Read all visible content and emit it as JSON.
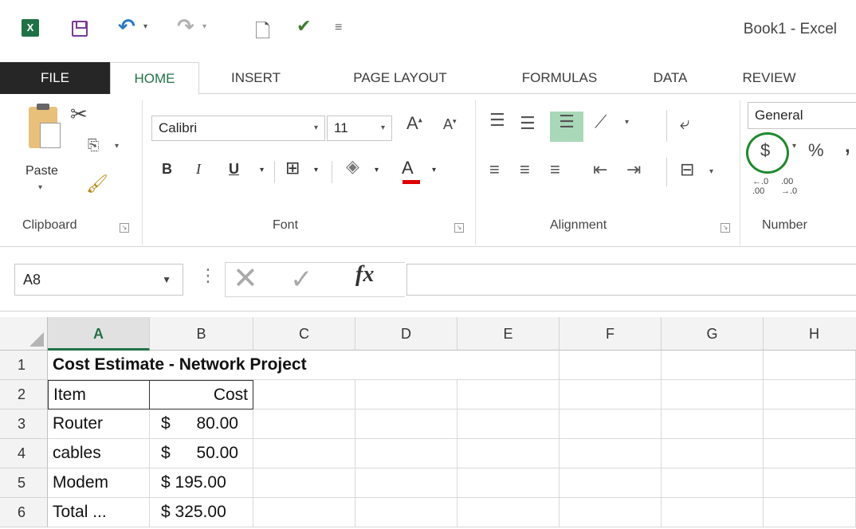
{
  "window": {
    "title": "Book1 - Excel"
  },
  "quick_access": {
    "logo_text": "X",
    "icons": [
      "excel-logo-icon",
      "save-icon",
      "undo-icon",
      "redo-icon",
      "print-preview-icon",
      "spelling-icon",
      "customize-qat-icon"
    ]
  },
  "tabs": {
    "file": "FILE",
    "home": "HOME",
    "insert": "INSERT",
    "page_layout": "PAGE LAYOUT",
    "formulas": "FORMULAS",
    "data": "DATA",
    "review": "REVIEW"
  },
  "ribbon": {
    "clipboard": {
      "paste_label": "Paste",
      "group_label": "Clipboard"
    },
    "font": {
      "font_name": "Calibri",
      "font_size": "11",
      "group_label": "Font",
      "bold": "B",
      "italic": "I",
      "underline": "U",
      "font_color": "#e00000"
    },
    "alignment": {
      "group_label": "Alignment"
    },
    "number": {
      "format": "General",
      "currency_symbol": "$",
      "percent_symbol": "%",
      "comma_symbol": ",",
      "increase_decimal": "←.0\n.00",
      "decrease_decimal": ".00\n→.0",
      "group_label": "Number",
      "highlight_color": "#1e8a2e"
    }
  },
  "formula_bar": {
    "name_box": "A8",
    "fx_label": "fx",
    "formula": ""
  },
  "grid": {
    "columns": [
      "A",
      "B",
      "C",
      "D",
      "E",
      "F",
      "G",
      "H"
    ],
    "active_column": "A",
    "rows": [
      "1",
      "2",
      "3",
      "4",
      "5",
      "6"
    ],
    "cells": {
      "A1": "Cost Estimate - Network Project",
      "A2": "Item",
      "B2": "Cost",
      "A3": "Router",
      "B3_sym": "$",
      "B3_val": "80.00",
      "A4": "cables",
      "B4_sym": "$",
      "B4_val": "50.00",
      "A5": "Modem",
      "B5": "$ 195.00",
      "A6": "Total ...",
      "B6": "$ 325.00"
    }
  },
  "colors": {
    "accent": "#217346",
    "file_tab_bg": "#262626"
  }
}
